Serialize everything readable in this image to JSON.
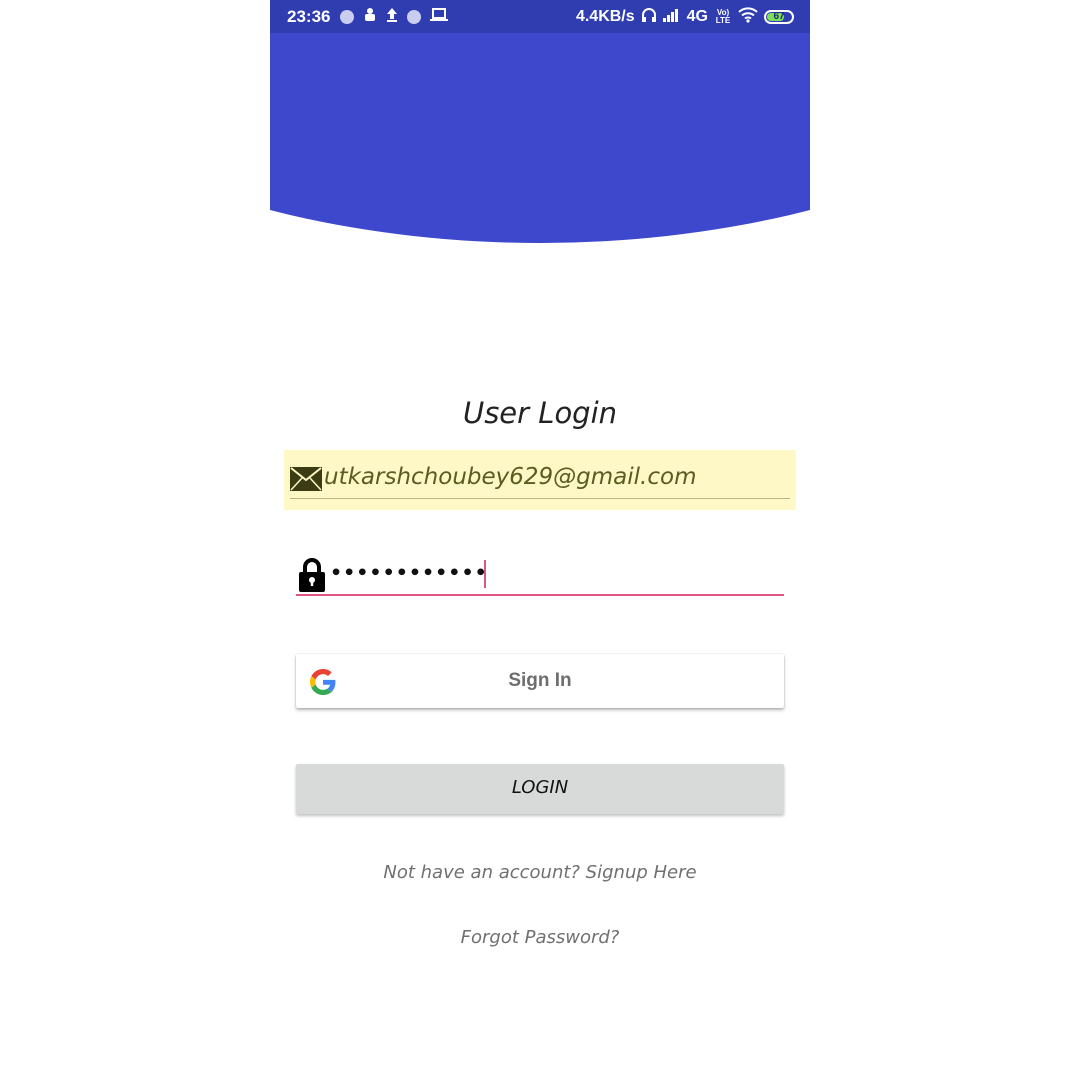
{
  "status_bar": {
    "time": "23:36",
    "network_speed": "4.4KB/s",
    "network_type": "4G",
    "volte_label": "Vo) LTE",
    "battery_level": "67",
    "icons": [
      "circle-notification-icon",
      "android-debug-icon",
      "upload-icon",
      "circle-notification-icon",
      "laptop-icon",
      "headphones-icon",
      "signal-icon",
      "wifi-icon",
      "battery-icon"
    ]
  },
  "colors": {
    "header": "#3e48cc",
    "status_bar": "#2f3db0",
    "accent": "#e05384",
    "autofill_bg": "#fdf8c5",
    "login_button": "#d8d9d9"
  },
  "login": {
    "title": "User Login",
    "email_icon": "envelope-icon",
    "email_value": "utkarshchoubey629@gmail.com",
    "password_icon": "lock-icon",
    "password_mask": "••••••••••••",
    "google_button_label": "Sign In",
    "google_icon": "google-g-icon",
    "login_button_label": "LOGIN",
    "signup_link": "Not have an account? Signup Here",
    "forgot_link": "Forgot Password?"
  }
}
